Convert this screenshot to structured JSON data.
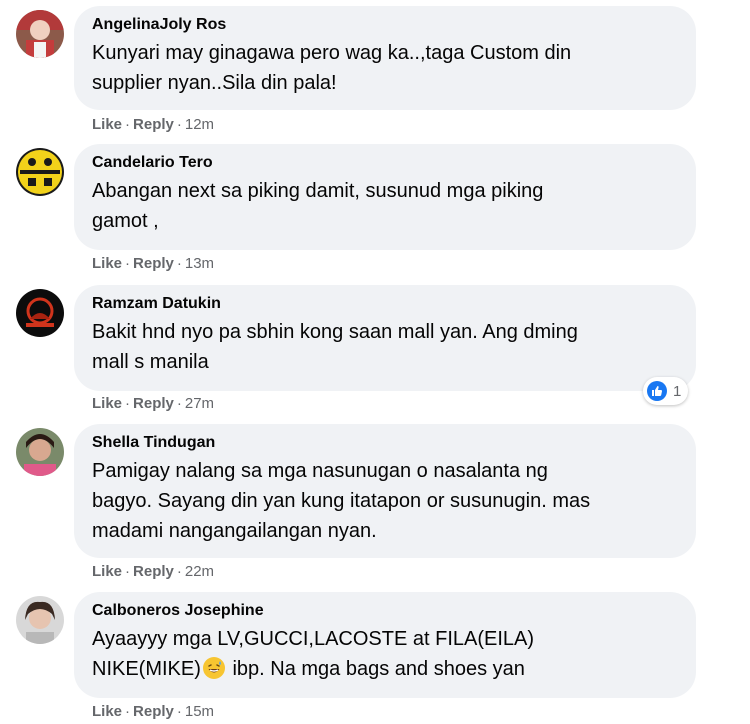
{
  "comments": [
    {
      "author": "AngelinaJoly Ros",
      "line1": "Kunyari may ginagawa pero wag ka..,taga Custom din",
      "line2": "supplier nyan..Sila din pala!",
      "like": "Like",
      "reply": "Reply",
      "time": "12m"
    },
    {
      "author": "Candelario Tero",
      "line1": "Abangan next sa piking damit, susunud mga piking",
      "line2": "gamot ,",
      "like": "Like",
      "reply": "Reply",
      "time": "13m"
    },
    {
      "author": "Ramzam Datukin",
      "line1": "Bakit hnd nyo pa sbhin kong saan mall yan. Ang dming",
      "line2": "mall s manila",
      "like": "Like",
      "reply": "Reply",
      "time": "27m",
      "reaction_count": "1"
    },
    {
      "author": "Shella Tindugan",
      "line1": "Pamigay nalang sa mga nasunugan o nasalanta ng",
      "line2": "bagyo. Sayang din yan kung itatapon or susunugin. mas",
      "line3": "madami nangangailangan nyan.",
      "like": "Like",
      "reply": "Reply",
      "time": "22m"
    },
    {
      "author": "Calboneros Josephine",
      "line1": "Ayaayyy mga LV,GUCCI,LACOSTE at FILA(EILA)",
      "line2a": "NIKE(MIKE)",
      "line2b": " ibp. Na mga bags and shoes yan",
      "like": "Like",
      "reply": "Reply",
      "time": "15m"
    }
  ],
  "separator": "·",
  "colors": {
    "bubble": "#f0f2f5",
    "meta_text": "#65676b",
    "like_blue": "#1877f2"
  }
}
